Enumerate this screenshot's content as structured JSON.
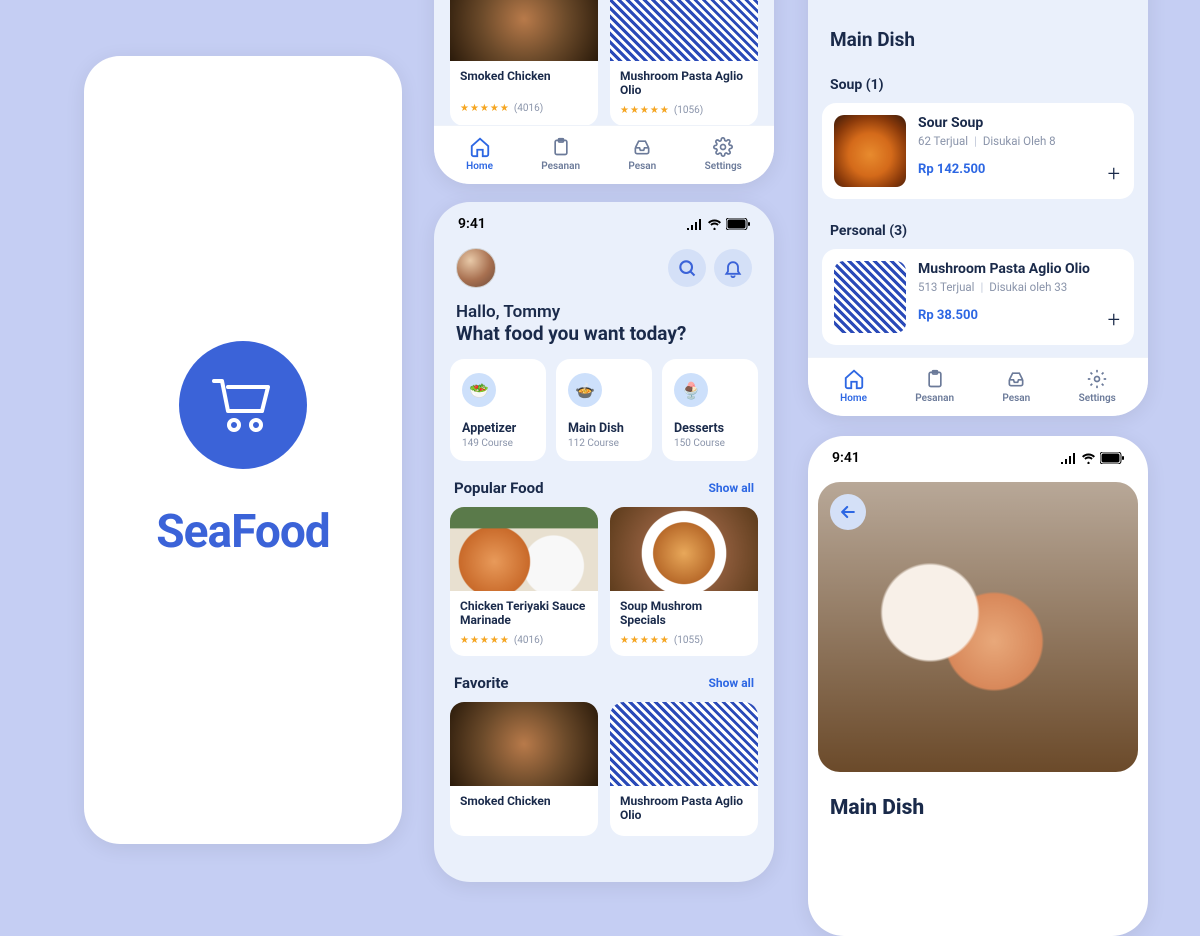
{
  "brand": "SeaFood",
  "status_time": "9:41",
  "greeting": {
    "line1": "Hallo, Tommy",
    "line2": "What food you want today?"
  },
  "categories": [
    {
      "name": "Appetizer",
      "sub": "149 Course",
      "icon": "🥗"
    },
    {
      "name": "Main Dish",
      "sub": "112 Course",
      "icon": "🍲"
    },
    {
      "name": "Desserts",
      "sub": "150 Course",
      "icon": "🍨"
    }
  ],
  "sections": {
    "popular": {
      "title": "Popular Food",
      "show_all": "Show all"
    },
    "favorite": {
      "title": "Favorite",
      "show_all": "Show all"
    }
  },
  "popular": [
    {
      "title": "Chicken  Teriyaki Sauce Marinade",
      "reviews": "(4016)"
    },
    {
      "title": "Soup Mushrom Specials",
      "reviews": "(1055)"
    }
  ],
  "favorite": [
    {
      "title": "Smoked Chicken",
      "reviews": "(4016)"
    },
    {
      "title": "Mushroom  Pasta Aglio Olio",
      "reviews": "(1056)"
    }
  ],
  "nav": [
    {
      "label": "Home"
    },
    {
      "label": "Pesanan"
    },
    {
      "label": "Pesan"
    },
    {
      "label": "Settings"
    }
  ],
  "main_dish_page": {
    "title": "Main Dish",
    "groups": [
      {
        "header": "Soup (1)",
        "item": {
          "name": "Sour Soup",
          "sold": "62 Terjual",
          "liked": "Disukai Oleh 8",
          "price": "Rp 142.500"
        }
      },
      {
        "header": "Personal (3)",
        "item": {
          "name": "Mushroom Pasta Aglio Olio",
          "sold": "513 Terjual",
          "liked": "Disukai oleh 33",
          "price": "Rp 38.500"
        }
      }
    ]
  },
  "detail": {
    "title": "Main Dish"
  }
}
